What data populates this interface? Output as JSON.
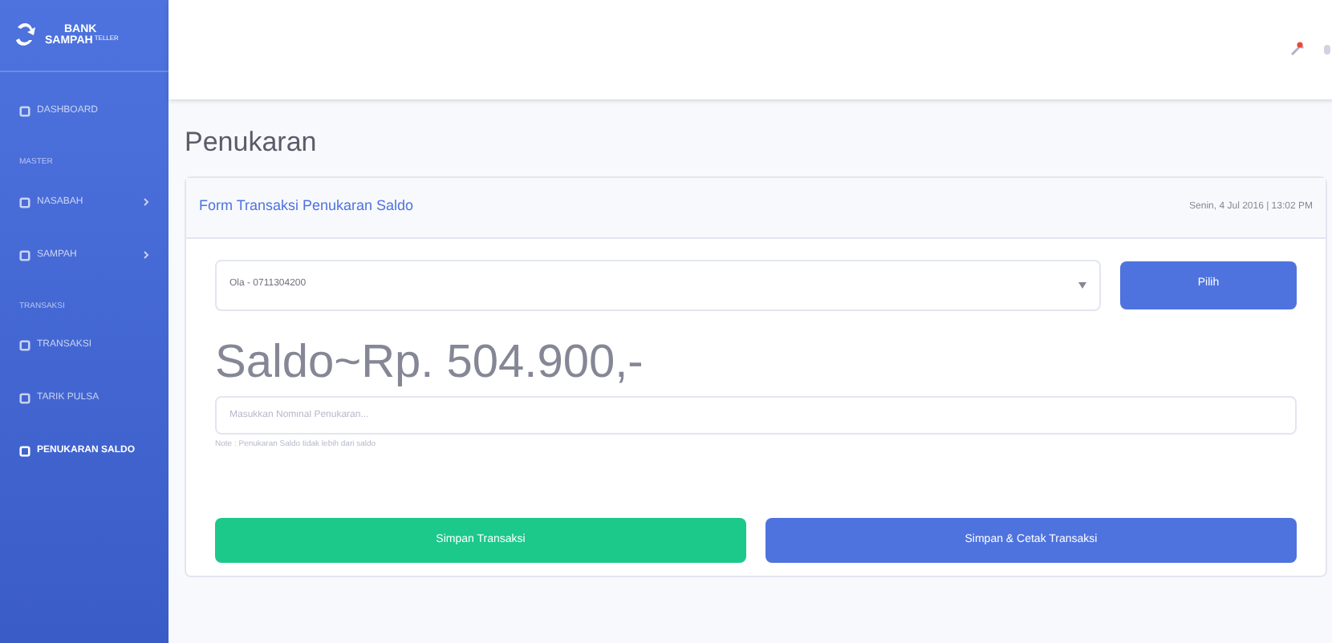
{
  "brand": {
    "line1": "BANK",
    "line2": "SAMPAH",
    "sup": "TELLER"
  },
  "sidebar": {
    "items": [
      {
        "kind": "item",
        "label": "DASHBOARD",
        "selected": false,
        "expandable": false
      },
      {
        "kind": "heading",
        "label": "MASTER"
      },
      {
        "kind": "item",
        "label": "NASABAH",
        "selected": false,
        "expandable": true
      },
      {
        "kind": "item",
        "label": "SAMPAH",
        "selected": false,
        "expandable": true
      },
      {
        "kind": "heading",
        "label": "TRANSAKSI"
      },
      {
        "kind": "item",
        "label": "TRANSAKSI",
        "selected": false,
        "expandable": false
      },
      {
        "kind": "item",
        "label": "TARIK PULSA",
        "selected": false,
        "expandable": false
      },
      {
        "kind": "item",
        "label": "PENUKARAN SALDO",
        "selected": true,
        "expandable": false
      }
    ]
  },
  "page_title": "Penukaran",
  "card": {
    "title": "Form Transaksi Penukaran Saldo",
    "date": "Senin, 4 Jul 2016 | 13:02 PM",
    "select_value": "Ola - 0711304200",
    "pick_button": "Pilih",
    "balance": "Saldo~Rp. 504.900,-",
    "amount_placeholder": "Masukkan Nominal Penukaran...",
    "note": "Note : Penukaran Saldo tidak lebih dari saldo",
    "buttons": [
      {
        "kind": "success",
        "label": "Simpan Transaksi"
      },
      {
        "kind": "primary",
        "label": "Simpan & Cetak Transaksi"
      }
    ]
  }
}
